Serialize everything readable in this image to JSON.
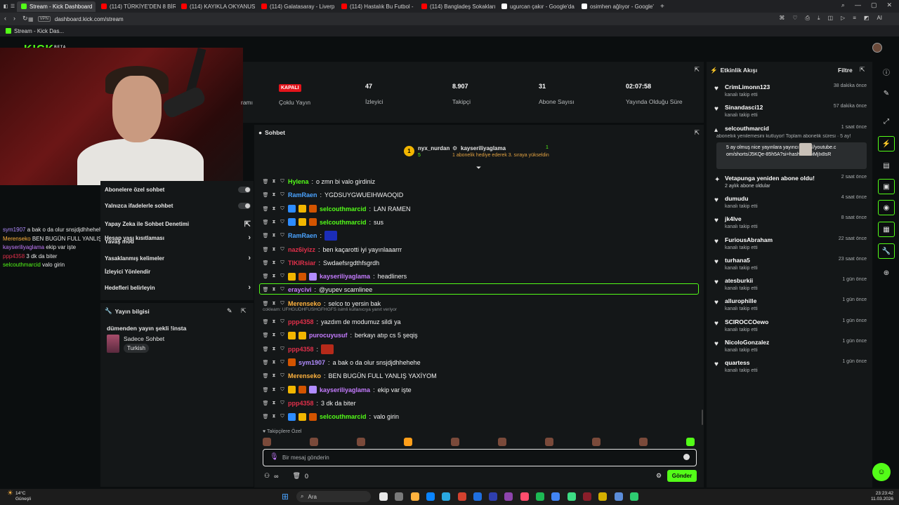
{
  "browser": {
    "tabs": [
      {
        "label": "Stream - Kick Dashboard",
        "color": "#53fc18",
        "active": true
      },
      {
        "label": "(114) TÜRKİYE'DEN 8 BİR",
        "color": "#ff0000"
      },
      {
        "label": "(114) KAYIKLA OKYANUS",
        "color": "#ff0000"
      },
      {
        "label": "(114) Galatasaray - Liverp",
        "color": "#ff0000"
      },
      {
        "label": "(114) Hastalık Bu Futbol -",
        "color": "#ff0000"
      },
      {
        "label": "(114) Bangladeş Sokakları",
        "color": "#ff0000"
      },
      {
        "label": "ugurcan çakır - Google'da",
        "color": "#ffffff"
      },
      {
        "label": "osimhen ağlıyor - Google'",
        "color": "#ffffff"
      }
    ],
    "url": "dashboard.kick.com/stream",
    "vpn": "VPN",
    "bookmark": "Stream - Kick Das...",
    "ai_label": "AI"
  },
  "brand": {
    "logo": "KICK",
    "beta": "BETA"
  },
  "left_overlay_chat": [
    {
      "user": "sym1907",
      "color": "#b18cff",
      "text": "a bak o da olur snsjdjdhhehehe"
    },
    {
      "user": "Merenseko",
      "color": "#ffb23e",
      "text": "BEN BUGÜN FULL YANLIŞ YAXİYOM"
    },
    {
      "user": "kayseriliyaglama",
      "color": "#c57cff",
      "text": "ekip var işte"
    },
    {
      "user": "ppp4358",
      "color": "#e0304a",
      "text": "3 dk da biter"
    },
    {
      "user": "selcouthmarcid",
      "color": "#53fc18",
      "text": "valo girin"
    }
  ],
  "settings": {
    "items": [
      {
        "label": "Abonelere özel sohbet",
        "control": "toggle"
      },
      {
        "label": "Yalnızca ifadelerle sohbet",
        "control": "toggle"
      },
      {
        "label": "Yapay Zeka ile Sohbet Denetimi",
        "control": "external"
      },
      {
        "label": "Hesap yaşı kısıtlaması",
        "control": "chevron"
      },
      {
        "label": "Yasaklanmış kelimeler",
        "control": "chevron"
      },
      {
        "label": "İzleyici Yönlendir",
        "control": "none"
      },
      {
        "label": "Hedefleri belirleyin",
        "control": "chevron"
      }
    ],
    "overlap_text": "Yavaş mod"
  },
  "stream_info": {
    "title": "Yayın bilgisi",
    "stream_title": "dümenden yayın şekli !insta",
    "category": "Sadece Sohbet",
    "language": "Turkish"
  },
  "stats": {
    "partial_label": "ramı",
    "status_badge": "KAPALI",
    "multi_label": "Çoklu Yayın",
    "viewers_value": "47",
    "viewers_label": "İzleyici",
    "followers_value": "8.907",
    "followers_label": "Takipçi",
    "subs_value": "31",
    "subs_label": "Abone Sayısı",
    "uptime_value": "02:07:58",
    "uptime_label": "Yayında Olduğu Süre"
  },
  "chat": {
    "title": "Sohbet",
    "leaderboard": {
      "first_user": "nyx_nurdan",
      "first_count": "5",
      "gifter": "kayseriliyaglama",
      "gifter_count": "1",
      "gift_note": "1 abonelik hediye ederek 3. sıraya yükseldin"
    },
    "messages": [
      {
        "user": "Hylena",
        "color": "#53fc18",
        "badges": [],
        "text": "o zmn bi valo girdiniz"
      },
      {
        "user": "RamRaen",
        "color": "#4aa3ff",
        "badges": [],
        "text": "YGDSUYGWUEIHWAOQID"
      },
      {
        "user": "selcouthmarcid",
        "color": "#53fc18",
        "badges": [
          "#2d8cff",
          "#f2b600",
          "#d35400"
        ],
        "text": "LAN RAMEN"
      },
      {
        "user": "selcouthmarcid",
        "color": "#53fc18",
        "badges": [
          "#2d8cff",
          "#f2b600",
          "#d35400"
        ],
        "text": "sus"
      },
      {
        "user": "RamRaen",
        "color": "#4aa3ff",
        "badges": [],
        "text": "",
        "emote": "#1b2db8"
      },
      {
        "user": "naz6iyizz",
        "color": "#e0304a",
        "badges": [],
        "text": "ben kaçarotti iyi yayınlaaarrr"
      },
      {
        "user": "TIKIRsiar",
        "color": "#e0304a",
        "badges": [],
        "text": "Swdaefsrgdthfsgrdh"
      },
      {
        "user": "kayseriliyaglama",
        "color": "#c57cff",
        "badges": [
          "#f2b600",
          "#d35400",
          "#b18cff"
        ],
        "text": "headliners"
      },
      {
        "user": "eraycivi",
        "color": "#c57cff",
        "badges": [],
        "text": "@yupev scamlinee",
        "highlight": true
      },
      {
        "user": "Merenseko",
        "color": "#ffb23e",
        "badges": [],
        "text": "selco to yersin bak"
      },
      {
        "user": "ppp4358",
        "color": "#e0304a",
        "badges": [],
        "text": "yazdım de modumuz sildi ya",
        "reply": "cokleam: UFHGUDHFUSHGFHGFS isimli kullanıcıya yanıt veriyor"
      },
      {
        "user": "purocuyusuf",
        "color": "#c57cff",
        "badges": [
          "#f2b600",
          "#f2b600"
        ],
        "text": "berkayı atıp cs 5 şeqiş"
      },
      {
        "user": "ppp4358",
        "color": "#e0304a",
        "badges": [],
        "text": "",
        "emote": "#b62a1a"
      },
      {
        "user": "sym1907",
        "color": "#b18cff",
        "badges": [
          "#d35400"
        ],
        "text": "a bak o da olur snsjdjdhhehehe"
      },
      {
        "user": "Merenseko",
        "color": "#ffb23e",
        "badges": [],
        "text": "BEN BUGÜN FULL YANLIŞ YAXİYOM"
      },
      {
        "user": "kayseriliyaglama",
        "color": "#c57cff",
        "badges": [
          "#f2b600",
          "#d35400",
          "#b18cff"
        ],
        "text": "ekip var işte"
      },
      {
        "user": "ppp4358",
        "color": "#e0304a",
        "badges": [],
        "text": "3 dk da biter"
      },
      {
        "user": "selcouthmarcid",
        "color": "#53fc18",
        "badges": [
          "#2d8cff",
          "#f2b600",
          "#d35400"
        ],
        "text": "valo girin"
      }
    ],
    "followers_only_label": "Takipçilere Özel",
    "input_placeholder": "Bir mesaj gönderin",
    "send_label": "Gönder",
    "footer_count": "0",
    "footer_infinity": "∞"
  },
  "activity": {
    "title": "Etkinlik Akışı",
    "filter": "Filtre",
    "items": [
      {
        "name": "CrimLimonn123",
        "sub": "kanalı takip etti",
        "time": "38 dakika önce"
      },
      {
        "name": "Sinandasci12",
        "sub": "kanalı takip etti",
        "time": "57 dakika önce"
      },
      {
        "name": "selcouthmarcid",
        "sub": "aboneliık yenilemesini kutluyor! Toplam abonelik süresi · 5 ay!",
        "time": "1 saat önce",
        "type": "resub",
        "resub_msg": "5 ay olmuş nice yayınlara yayıncı https://youtube.com/shorts/J5KQe-85h5A?si=hashYembiMjIx8sR"
      },
      {
        "name": "Vetapunga yeniden abone oldu!",
        "sub": "2 aylık abone oldular",
        "time": "2 saat önce",
        "type": "sub"
      },
      {
        "name": "dumudu",
        "sub": "kanalı takip etti",
        "time": "4 saat önce"
      },
      {
        "name": "jk4lve",
        "sub": "kanalı takip etti",
        "time": "8 saat önce"
      },
      {
        "name": "FuriousAbraham",
        "sub": "kanalı takip etti",
        "time": "22 saat önce"
      },
      {
        "name": "turhana5",
        "sub": "kanalı takip etti",
        "time": "23 saat önce"
      },
      {
        "name": "atesburkii",
        "sub": "kanalı takip etti",
        "time": "1 gün önce"
      },
      {
        "name": "allurophille",
        "sub": "kanalı takip etti",
        "time": "1 gün önce"
      },
      {
        "name": "SCIROCCOewo",
        "sub": "kanalı takip etti",
        "time": "1 gün önce"
      },
      {
        "name": "NicoloGonzalez",
        "sub": "kanalı takip etti",
        "time": "1 gün önce"
      },
      {
        "name": "quartess",
        "sub": "kanalı takip etti",
        "time": "1 gün önce"
      }
    ]
  },
  "taskbar": {
    "weather_temp": "14°C",
    "weather_desc": "Güneşli",
    "search": "Ara",
    "time": "23:23:42",
    "date": "11.03.2026"
  },
  "colors": {
    "accent": "#53fc18",
    "panel": "#141718",
    "bg": "#0b0e0f",
    "live_red": "#e3141b"
  }
}
